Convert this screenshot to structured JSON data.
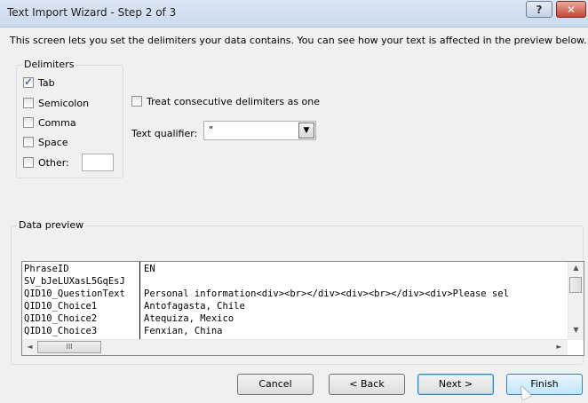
{
  "window": {
    "title": "Text Import Wizard - Step 2 of 3",
    "help_label": "?",
    "close_label": "✕"
  },
  "intro": "This screen lets you set the delimiters your data contains.  You can see how your text is affected in the preview below.",
  "delimiters": {
    "legend": "Delimiters",
    "items": [
      {
        "label": "Tab",
        "checked": true
      },
      {
        "label": "Semicolon",
        "checked": false
      },
      {
        "label": "Comma",
        "checked": false
      },
      {
        "label": "Space",
        "checked": false
      },
      {
        "label": "Other:",
        "checked": false
      }
    ],
    "other_value": ""
  },
  "treat_consecutive": {
    "label": "Treat consecutive delimiters as one",
    "checked": false
  },
  "text_qualifier": {
    "label": "Text qualifier:",
    "value": "\""
  },
  "preview": {
    "legend": "Data preview",
    "rows": [
      {
        "c1": "PhraseID",
        "c2": "EN"
      },
      {
        "c1": "SV_bJeLUXasL5GqEsJ",
        "c2": ""
      },
      {
        "c1": "QID10_QuestionText",
        "c2": "Personal information<div><br></div><div><br></div><div>Please sel"
      },
      {
        "c1": "QID10_Choice1",
        "c2": "Antofagasta, Chile"
      },
      {
        "c1": "QID10_Choice2",
        "c2": "Atequiza, Mexico"
      },
      {
        "c1": "QID10_Choice3",
        "c2": "Fenxian, China"
      }
    ]
  },
  "buttons": {
    "cancel": "Cancel",
    "back": "< Back",
    "next": "Next >",
    "finish": "Finish"
  },
  "icons": {
    "scroll_up": "▲",
    "scroll_down": "▼",
    "scroll_left": "◄",
    "scroll_right": "►",
    "dropdown": "▼",
    "thumb_grip": "III"
  }
}
